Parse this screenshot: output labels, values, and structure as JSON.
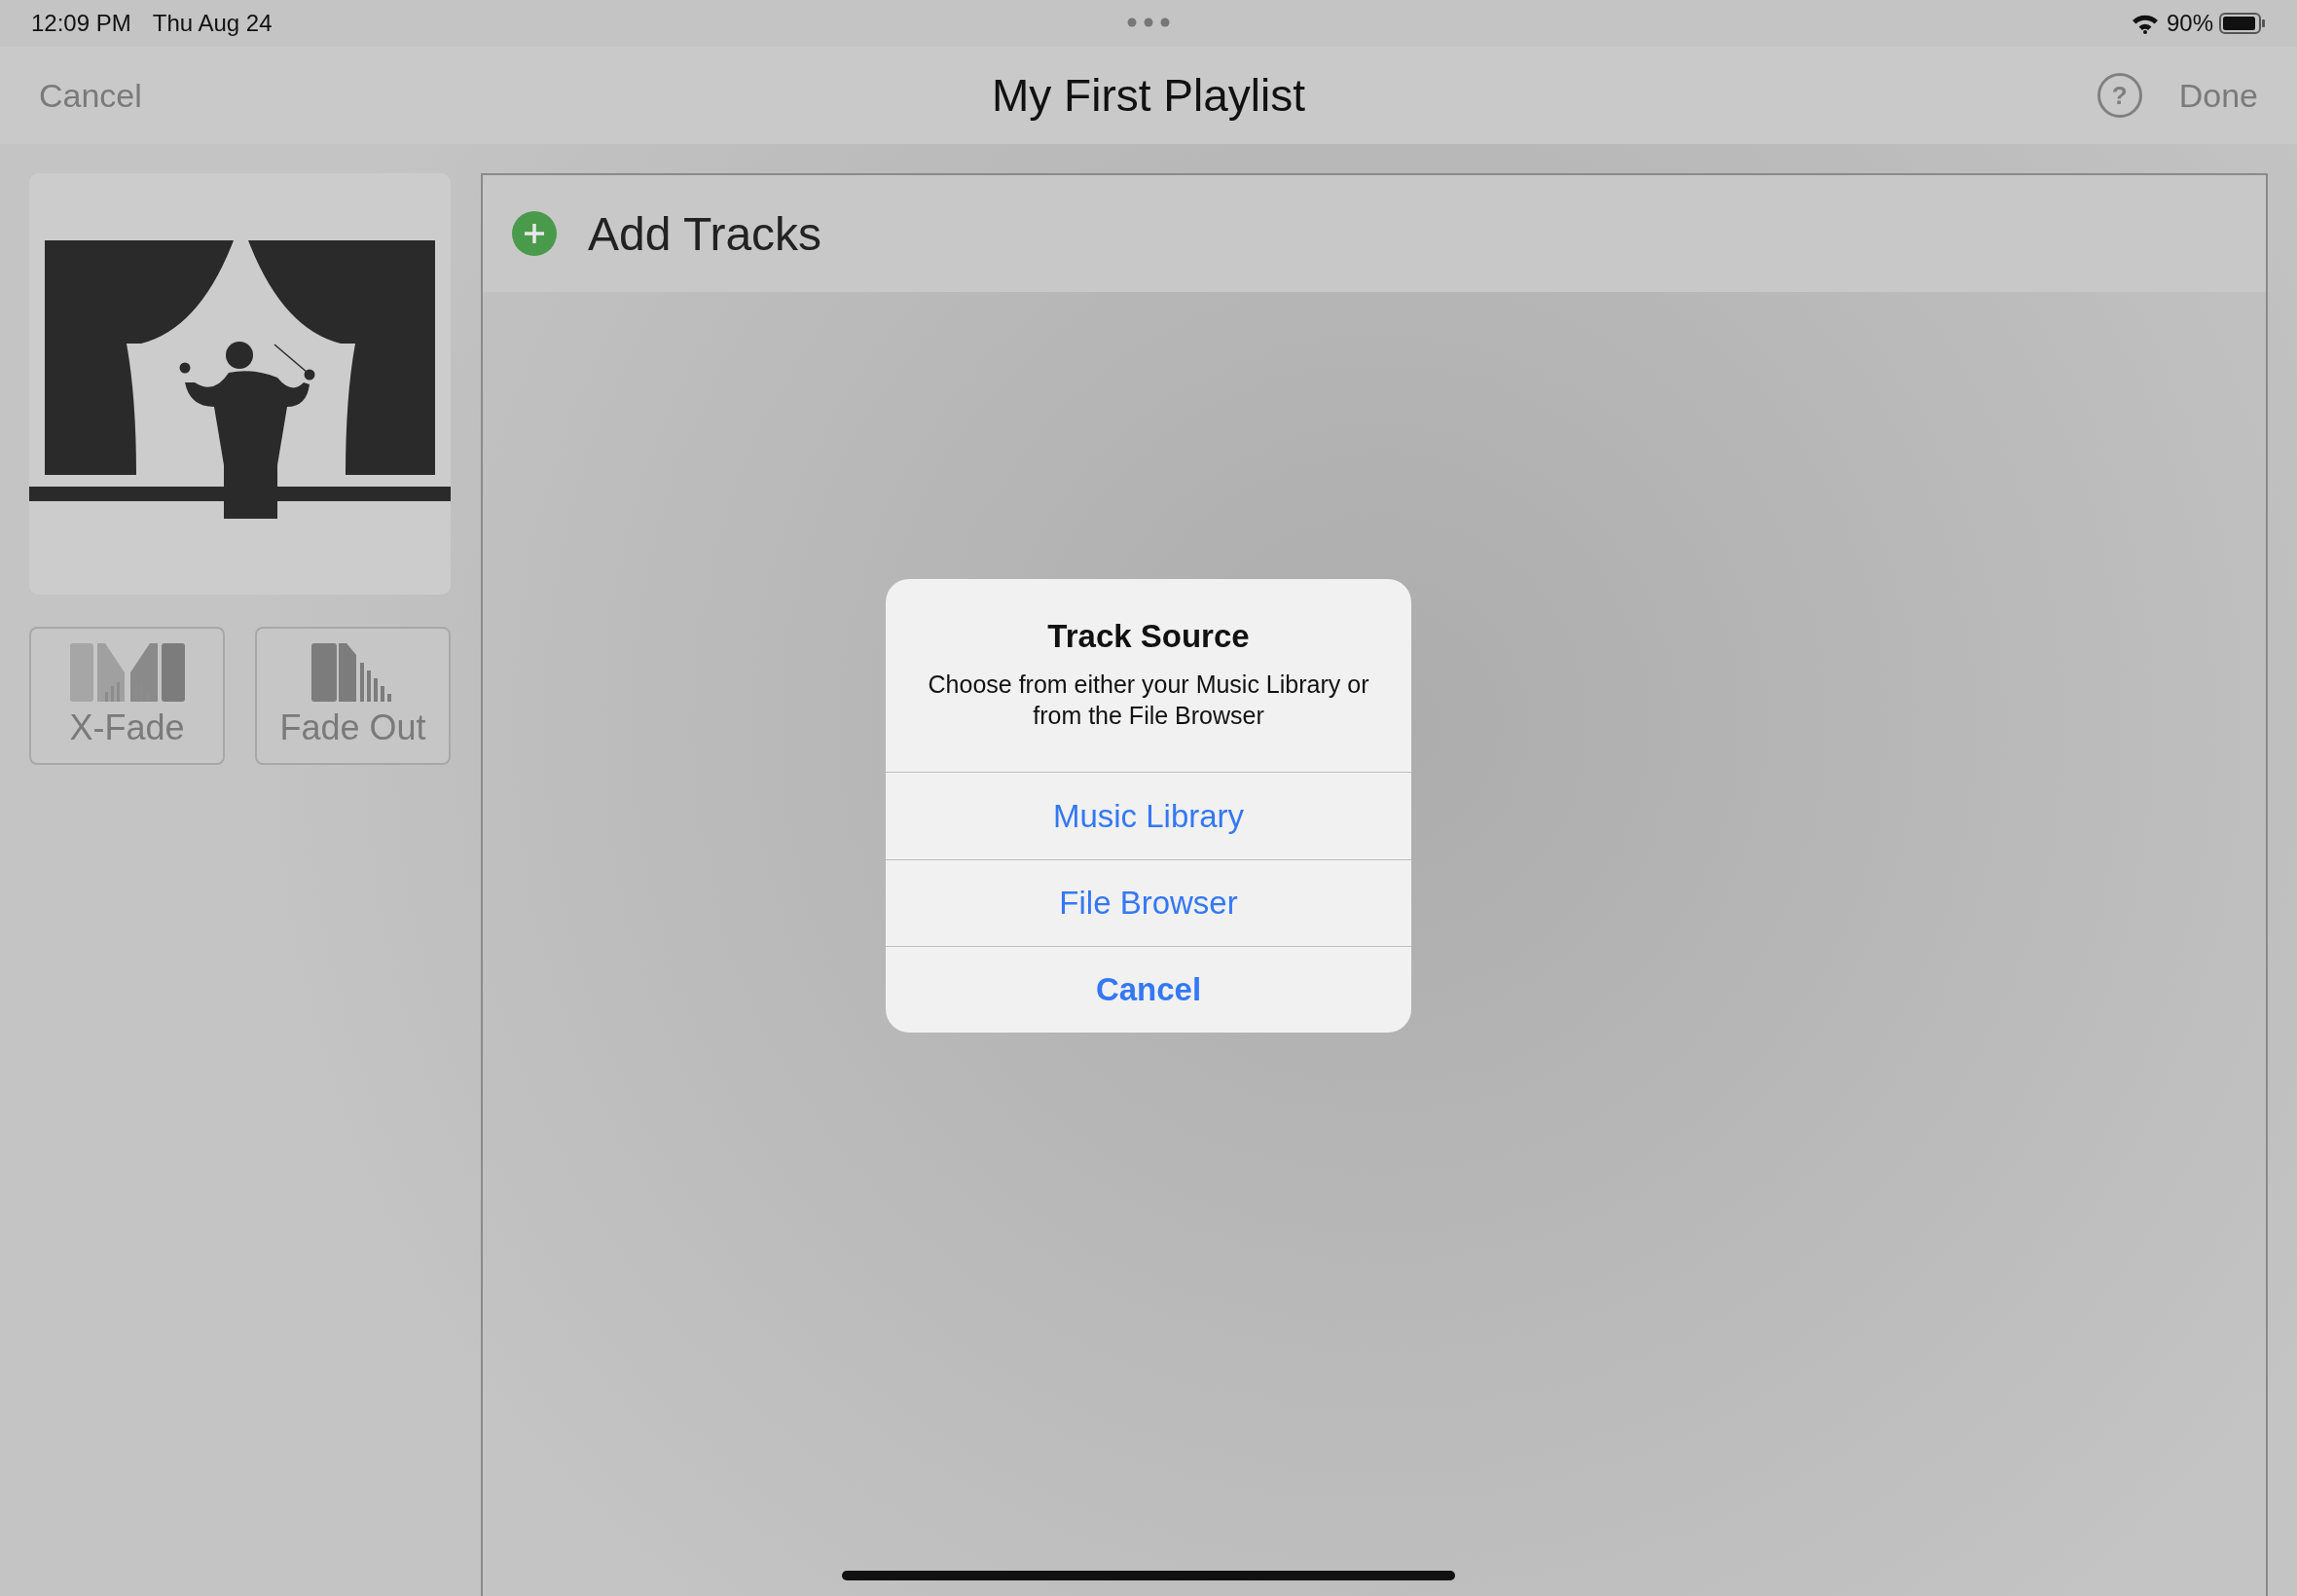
{
  "status_bar": {
    "time": "12:09 PM",
    "date": "Thu Aug 24",
    "battery": "90%"
  },
  "nav_bar": {
    "cancel": "Cancel",
    "title": "My First Playlist",
    "help": "?",
    "done": "Done"
  },
  "transitions": [
    {
      "kind": "crossfade",
      "label": "X-Fade"
    },
    {
      "kind": "fadeout",
      "label": "Fade Out"
    }
  ],
  "tracks_panel": {
    "add_label": "Add Tracks"
  },
  "dialog": {
    "title": "Track Source",
    "message": "Choose from either your Music Library or from the File Browser",
    "actions": [
      {
        "kind": "default",
        "label": "Music Library"
      },
      {
        "kind": "default",
        "label": "File Browser"
      },
      {
        "kind": "cancel",
        "label": "Cancel"
      }
    ]
  }
}
